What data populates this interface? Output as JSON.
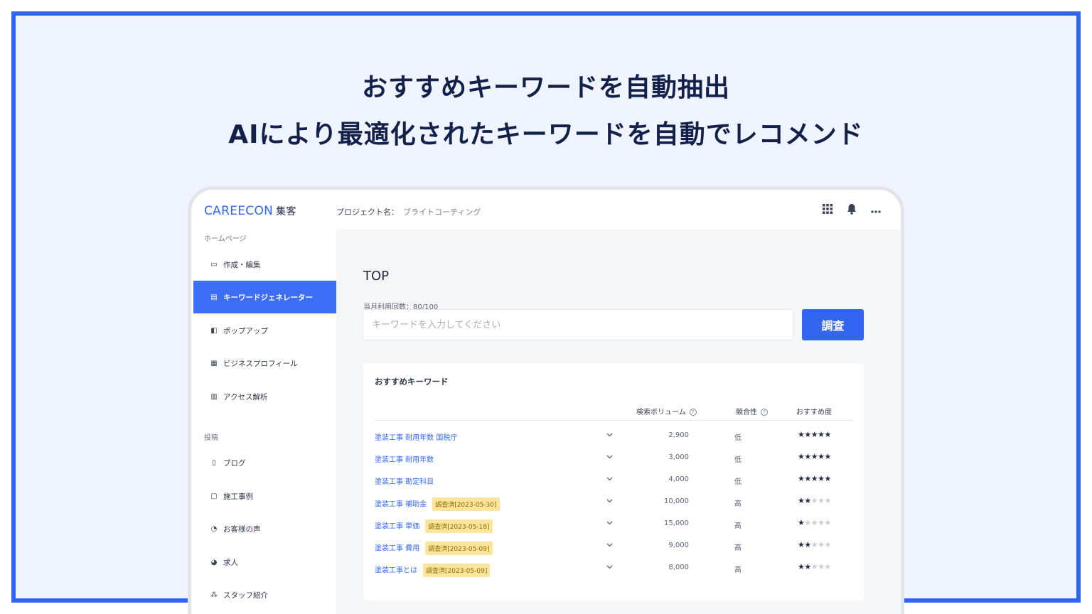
{
  "hero": {
    "line1": "おすすめキーワードを自動抽出",
    "line2": "AIにより最適化されたキーワードを自動でレコメンド"
  },
  "app": {
    "logo_main": "CAREECON",
    "logo_sub": "集客",
    "project_label": "プロジェクト名：",
    "project_name": "ブライトコーティング",
    "icons": [
      "apps-grid-icon",
      "bell-icon",
      "more-horizontal-icon"
    ]
  },
  "sidebar": {
    "section1": "ホームページ",
    "section2": "投稿",
    "items": [
      {
        "label": "作成・編集",
        "icon": "monitor-icon"
      },
      {
        "label": "キーワードジェネレーター",
        "icon": "document-search-icon"
      },
      {
        "label": "ポップアップ",
        "icon": "popup-icon"
      },
      {
        "label": "ビジネスプロフィール",
        "icon": "store-icon"
      },
      {
        "label": "アクセス解析",
        "icon": "chart-icon"
      },
      {
        "label": "ブログ",
        "icon": "blog-icon"
      },
      {
        "label": "施工事例",
        "icon": "briefcase-icon"
      },
      {
        "label": "お客様の声",
        "icon": "users-icon"
      },
      {
        "label": "求人",
        "icon": "recruit-icon"
      },
      {
        "label": "スタッフ紹介",
        "icon": "staff-icon"
      }
    ],
    "active_index": 1
  },
  "main": {
    "title": "TOP",
    "usage": "当月利用回数：80/100",
    "input_placeholder": "キーワードを入力してください",
    "search_button": "調査",
    "card_title": "おすすめキーワード",
    "columns": {
      "volume": "検索ボリューム",
      "competition": "競合性",
      "recommend": "おすすめ度"
    },
    "rows": [
      {
        "keyword": "塗装工事 耐用年数 国税庁",
        "badge": "",
        "volume": "2,900",
        "competition": "低",
        "stars": 5
      },
      {
        "keyword": "塗装工事 耐用年数",
        "badge": "",
        "volume": "3,000",
        "competition": "低",
        "stars": 5
      },
      {
        "keyword": "塗装工事 勘定科目",
        "badge": "",
        "volume": "4,000",
        "competition": "低",
        "stars": 5
      },
      {
        "keyword": "塗装工事 補助金",
        "badge": "調査済[2023-05-30]",
        "volume": "10,000",
        "competition": "高",
        "stars": 2
      },
      {
        "keyword": "塗装工事 単価",
        "badge": "調査済[2023-05-18]",
        "volume": "15,000",
        "competition": "高",
        "stars": 1
      },
      {
        "keyword": "塗装工事 費用",
        "badge": "調査済[2023-05-09]",
        "volume": "9,000",
        "competition": "高",
        "stars": 2
      },
      {
        "keyword": "塗装工事とは",
        "badge": "調査済[2023-05-09]",
        "volume": "8,000",
        "competition": "高",
        "stars": 2
      }
    ]
  },
  "colors": {
    "accent": "#3366f0",
    "frame_bg": "#f0f4fe",
    "badge_bg": "#fbe59b",
    "headline": "#13214a"
  }
}
